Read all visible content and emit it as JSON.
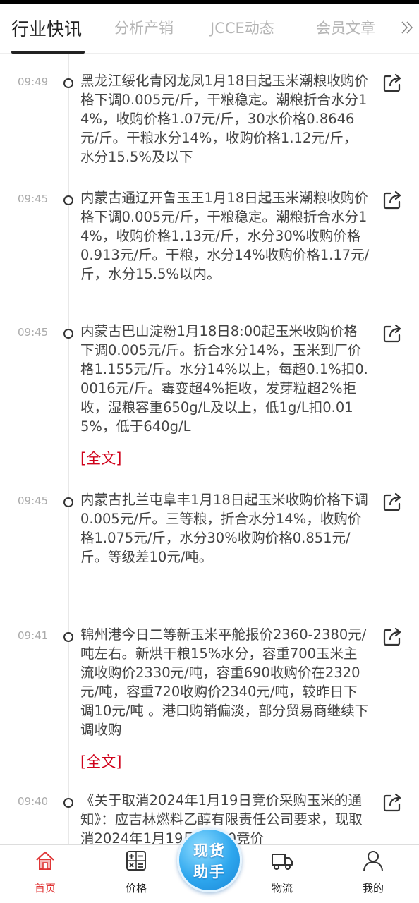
{
  "tabs": [
    {
      "label": "行业快讯",
      "active": true
    },
    {
      "label": "分析产销",
      "active": false
    },
    {
      "label": "JCCE动态",
      "active": false
    },
    {
      "label": "会员文章",
      "active": false
    }
  ],
  "more_icon": "double-chevron-right-icon",
  "news": [
    {
      "time": "09:49",
      "text": "黑龙江绥化青冈龙凤1月18日起玉米潮粮收购价格下调0.005元/斤，干粮稳定。潮粮折合水分14%，收购价格1.07元/斤，30水价格0.8646元/斤。干粮水分14%，收购价格1.12元/斤，水分15.5%及以下",
      "full": ""
    },
    {
      "time": "09:45",
      "text": "内蒙古通辽开鲁玉王1月18日起玉米潮粮收购价格下调0.005元/斤，干粮稳定。潮粮折合水分14%，收购价格1.13元/斤，水分30%收购价格0.913元/斤。干粮，水分14%收购价格1.17元/斤，水分15.5%以内。",
      "full": ""
    },
    {
      "time": "09:45",
      "text": "内蒙古巴山淀粉1月18日8:00起玉米收购价格下调0.005元/斤。折合水分14%，玉米到厂价格1.155元/斤。水分14%以上，每超0.1%扣0.0016元/斤。霉变超4%拒收，发芽粒超2%拒收，湿粮容重650g/L及以上，低1g/L扣0.015%，低于640g/L",
      "full": "[全文]"
    },
    {
      "time": "09:45",
      "text": "内蒙古扎兰屯阜丰1月18日起玉米收购价格下调0.005元/斤。三等粮，折合水分14%，收购价格1.075元/斤，水分30%收购价格0.851元/斤。等级差10元/吨。",
      "full": ""
    },
    {
      "time": "09:41",
      "text": "锦州港今日二等新玉米平舱报价2360-2380元/吨左右。新烘干粮15%水分，容重700玉米主流收购价2330元/吨，容重690收购价在2320元/吨，容重720收购价2340元/吨，较昨日下调10元/吨 。港口购销偏淡，部分贸易商继续下调收购",
      "full": "[全文]"
    },
    {
      "time": "09:40",
      "text": "《关于取消2024年1月19日竞价采购玉米的通知》：应吉林燃料乙醇有限责任公司要求，现取消2024年1月19日10:00竞价",
      "full": ""
    }
  ],
  "share_icon": "share-icon",
  "bottom_nav": [
    {
      "label": "首页",
      "icon": "home-icon",
      "active": true
    },
    {
      "label": "价格",
      "icon": "calculator-icon",
      "active": false
    },
    {
      "label": "物流",
      "icon": "truck-icon",
      "active": false
    },
    {
      "label": "我的",
      "icon": "user-icon",
      "active": false
    }
  ],
  "center_button": {
    "line1": "现货",
    "line2": "助手"
  },
  "colors": {
    "accent": "#e03636",
    "fulltext": "#d0021b",
    "center_btn": "#2ea7ee"
  }
}
